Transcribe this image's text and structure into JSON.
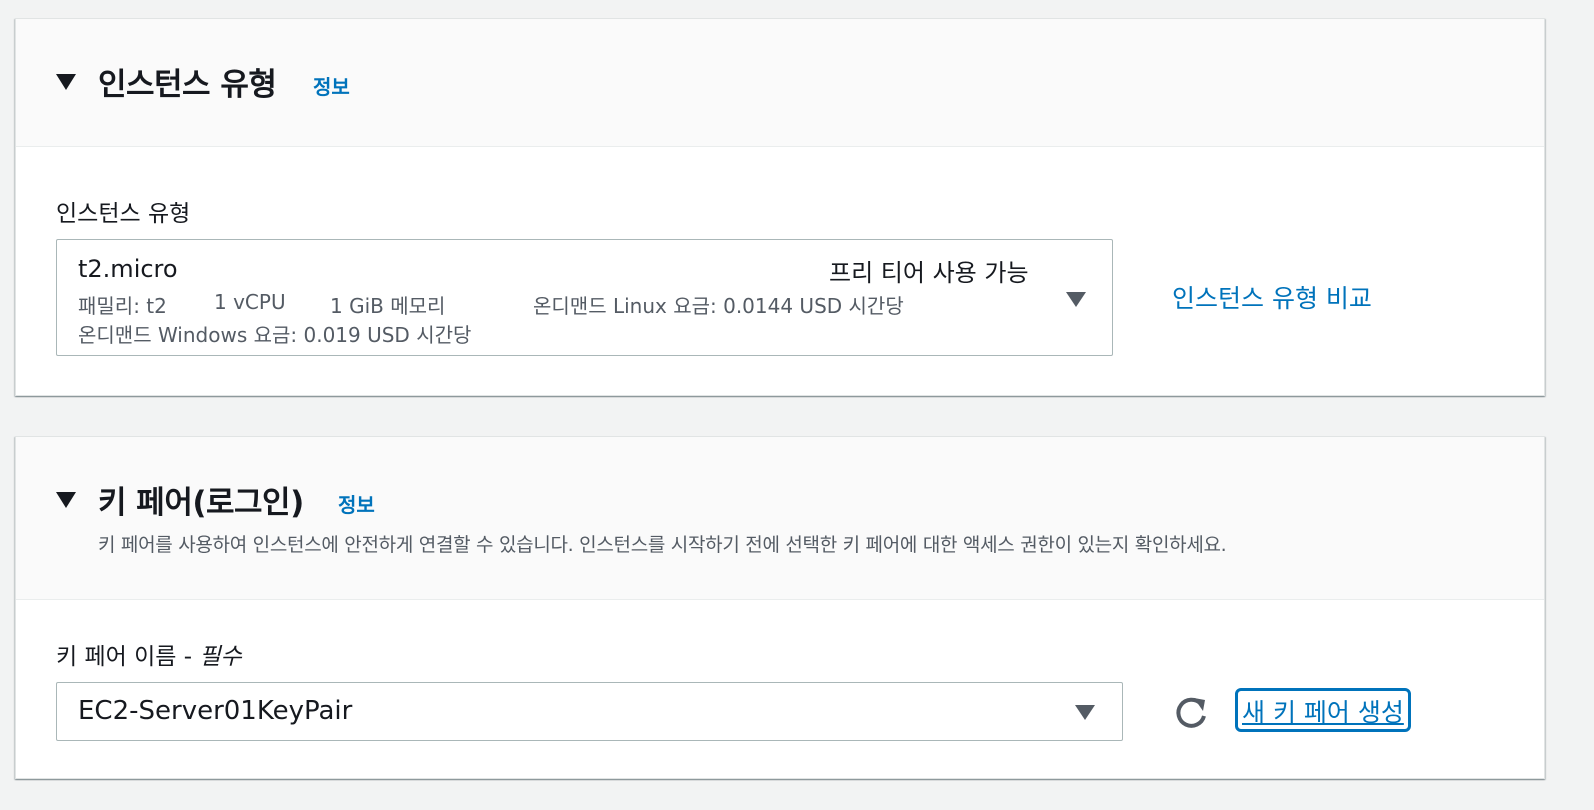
{
  "instance_type": {
    "section_title": "인스턴스 유형",
    "info_label": "정보",
    "field_label": "인스턴스 유형",
    "selected": {
      "name": "t2.micro",
      "tag": "프리 티어 사용 가능",
      "family": "패밀리: t2",
      "vcpu": "1 vCPU",
      "memory": "1 GiB 메모리",
      "linux_price": "온디맨드 Linux 요금: 0.0144 USD 시간당",
      "windows_price": "온디맨드 Windows 요금: 0.019 USD 시간당"
    },
    "compare_link": "인스턴스 유형 비교"
  },
  "key_pair": {
    "section_title": "키 페어(로그인)",
    "info_label": "정보",
    "description": "키 페어를 사용하여 인스턴스에 안전하게 연결할 수 있습니다. 인스턴스를 시작하기 전에 선택한 키 페어에 대한 액세스 권한이 있는지 확인하세요.",
    "field_label": "키 페어 이름 - ",
    "field_required": "필수",
    "selected_value": "EC2-Server01KeyPair",
    "create_link": "새 키 페어 생성"
  },
  "icons": {
    "section_caret": "caret-down-icon",
    "select_caret": "chevron-down-icon",
    "refresh": "refresh-icon"
  },
  "colors": {
    "link": "#0073bb",
    "text": "#16191f",
    "secondary_text": "#545b64",
    "page_background": "#f2f3f3"
  }
}
